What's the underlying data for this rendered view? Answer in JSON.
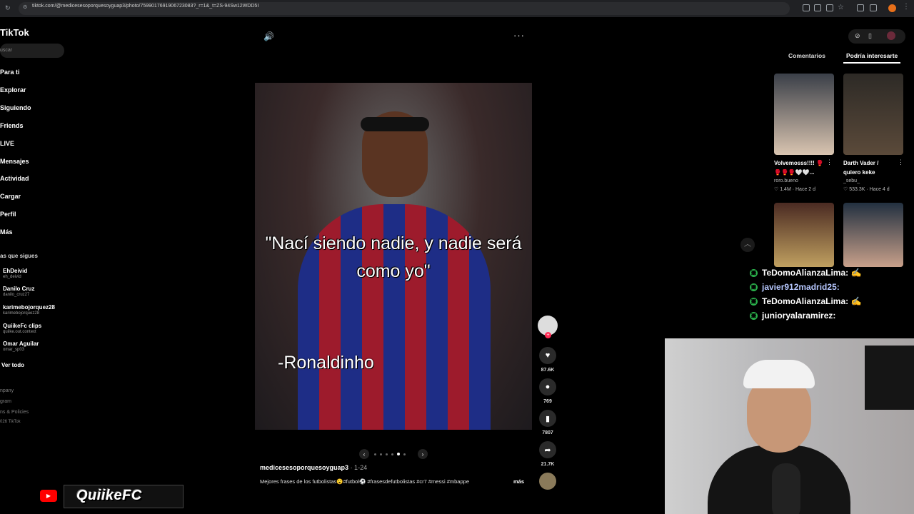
{
  "browser": {
    "url": "tiktok.com/@medicesesoporquesoyguap3/photo/7599017691906723083?_r=1&_t=ZS-94Sw12WDD5I"
  },
  "sidebar": {
    "logo": "TikTok",
    "search_placeholder": "uscar",
    "nav": [
      "Para ti",
      "Explorar",
      "Siguiendo",
      "Friends",
      "LIVE",
      "Mensajes",
      "Actividad",
      "Cargar",
      "Perfil",
      "Más"
    ],
    "following_header": "as que sigues",
    "following": [
      {
        "name": "EhDeivid",
        "user": "eh_deivid"
      },
      {
        "name": "Danilo Cruz",
        "user": "danilo_cruz27"
      },
      {
        "name": "karimebojorquez28",
        "user": "karimebojorquez28"
      },
      {
        "name": "QuiikeFc clips",
        "user": "quiike.out.context"
      },
      {
        "name": "Omar Aguilar",
        "user": "omar_sp03"
      }
    ],
    "see_all": "Ver todo",
    "footer": [
      "npany",
      "gram",
      "ns & Policies",
      "026 TikTok"
    ]
  },
  "post": {
    "quote": "\"Nací siendo nadie, y nadie será como yo\"",
    "author_text": "-Ronaldinho",
    "likes": "87.6K",
    "comments": "769",
    "saves": "7807",
    "shares": "21.7K",
    "username": "medicesesoporquesoyguap3",
    "date": "· 1-24",
    "caption": "Mejores frases de los futbolistas😮#futbol⚽ #frasesdefutbolistas #cr7 #messi #mbappe",
    "more": "más"
  },
  "right_panel": {
    "tabs": [
      "Comentarios",
      "Podría interesarte"
    ],
    "cards": [
      {
        "title": "Volvemosss!!!! 🥊",
        "subtitle": "🥊🥊🥊🤍🤍...",
        "user": "roro.bueno",
        "stats": "♡ 1.4M · Hace 2 d"
      },
      {
        "title": "Darth Vader /",
        "subtitle": "quiero keke",
        "user": "_sebu_",
        "stats": "♡ 533.3K · Hace 4 d"
      }
    ]
  },
  "chat": [
    {
      "user": "TeDomoAlianzaLima:"
    },
    {
      "user": "javier912madrid25:"
    },
    {
      "user": "TeDomoAlianzaLima:"
    },
    {
      "user": "junioryalaramirez:"
    }
  ],
  "branding": {
    "name": "QuiikeFC"
  }
}
